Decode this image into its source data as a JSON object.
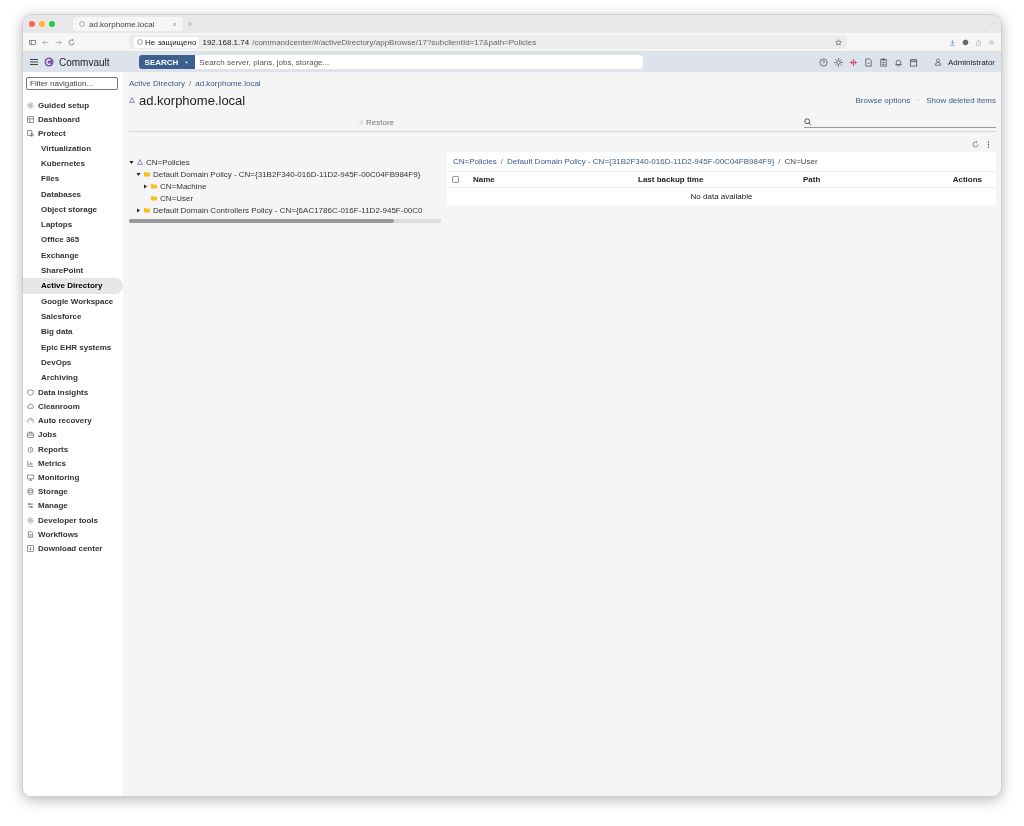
{
  "browser": {
    "tab_title": "ad.korphome.local",
    "security": "Не защищено",
    "url_host": "192.168.1.74",
    "url_path": "/commandcenter/#/activeDirectory/appBrowse/17?subclientId=17&path=Policies"
  },
  "header": {
    "brand": "Commvault",
    "search_button": "SEARCH",
    "search_placeholder": "Search server, plans, jobs, storage...",
    "user": "Administrator"
  },
  "sidebar": {
    "filter_placeholder": "Filter navigation...",
    "items": [
      {
        "label": "Guided setup",
        "kind": "top",
        "selected": false
      },
      {
        "label": "Dashboard",
        "kind": "top",
        "selected": false
      },
      {
        "label": "Protect",
        "kind": "top",
        "selected": false
      },
      {
        "label": "Virtualization",
        "kind": "sub",
        "selected": false
      },
      {
        "label": "Kubernetes",
        "kind": "sub",
        "selected": false
      },
      {
        "label": "Files",
        "kind": "sub",
        "selected": false
      },
      {
        "label": "Databases",
        "kind": "sub",
        "selected": false
      },
      {
        "label": "Object storage",
        "kind": "sub",
        "selected": false
      },
      {
        "label": "Laptops",
        "kind": "sub",
        "selected": false
      },
      {
        "label": "Office 365",
        "kind": "sub",
        "selected": false
      },
      {
        "label": "Exchange",
        "kind": "sub",
        "selected": false
      },
      {
        "label": "SharePoint",
        "kind": "sub",
        "selected": false
      },
      {
        "label": "Active Directory",
        "kind": "sub",
        "selected": true
      },
      {
        "label": "Google Workspace",
        "kind": "sub",
        "selected": false
      },
      {
        "label": "Salesforce",
        "kind": "sub",
        "selected": false
      },
      {
        "label": "Big data",
        "kind": "sub",
        "selected": false
      },
      {
        "label": "Epic EHR systems",
        "kind": "sub",
        "selected": false
      },
      {
        "label": "DevOps",
        "kind": "sub",
        "selected": false
      },
      {
        "label": "Archiving",
        "kind": "sub",
        "selected": false
      },
      {
        "label": "Data insights",
        "kind": "top",
        "selected": false
      },
      {
        "label": "Cleanroom",
        "kind": "top",
        "selected": false
      },
      {
        "label": "Auto recovery",
        "kind": "top",
        "selected": false
      },
      {
        "label": "Jobs",
        "kind": "top",
        "selected": false
      },
      {
        "label": "Reports",
        "kind": "top",
        "selected": false
      },
      {
        "label": "Metrics",
        "kind": "top",
        "selected": false
      },
      {
        "label": "Monitoring",
        "kind": "top",
        "selected": false
      },
      {
        "label": "Storage",
        "kind": "top",
        "selected": false
      },
      {
        "label": "Manage",
        "kind": "top",
        "selected": false
      },
      {
        "label": "Developer tools",
        "kind": "top",
        "selected": false
      },
      {
        "label": "Workflows",
        "kind": "top",
        "selected": false
      },
      {
        "label": "Download center",
        "kind": "top",
        "selected": false
      }
    ]
  },
  "breadcrumb": [
    {
      "kind": "link",
      "text": "Active Directory"
    },
    {
      "kind": "separator",
      "text": "/"
    },
    {
      "kind": "link",
      "text": "ad.korphome.local"
    }
  ],
  "title": "ad.korphome.local",
  "actions": [
    "Browse options",
    "Show deleted items"
  ],
  "toolbar": {
    "restore": "Restore",
    "restore_disabled": true
  },
  "tree": [
    {
      "label": "CN=Policies",
      "kind": "domain",
      "expanded": true,
      "children": [
        {
          "label": "Default Domain Policy - CN={31B2F340-016D-11D2-945F-00C04FB984F9}",
          "kind": "folder",
          "expanded": true,
          "children": [
            {
              "label": "CN=Machine",
              "kind": "folder",
              "expanded": false
            },
            {
              "label": "CN=User",
              "kind": "folder"
            }
          ]
        },
        {
          "label": "Default Domain Controllers Policy - CN={6AC1786C-016F-11D2-945F-00C0",
          "kind": "folder",
          "expanded": false
        }
      ]
    }
  ],
  "path": [
    {
      "kind": "link",
      "text": "CN=Policies"
    },
    {
      "kind": "separator",
      "text": "/"
    },
    {
      "kind": "link",
      "text": "Default Domain Policy - CN={31B2F340-016D-11D2-945F-00C04FB984F9}"
    },
    {
      "kind": "separator",
      "text": "/"
    },
    {
      "kind": "current",
      "text": "CN=User"
    }
  ],
  "table": {
    "select_all_checked": false,
    "columns": [
      "Name",
      "Last backup time",
      "Path",
      "Actions"
    ],
    "empty_message": "No data available"
  }
}
